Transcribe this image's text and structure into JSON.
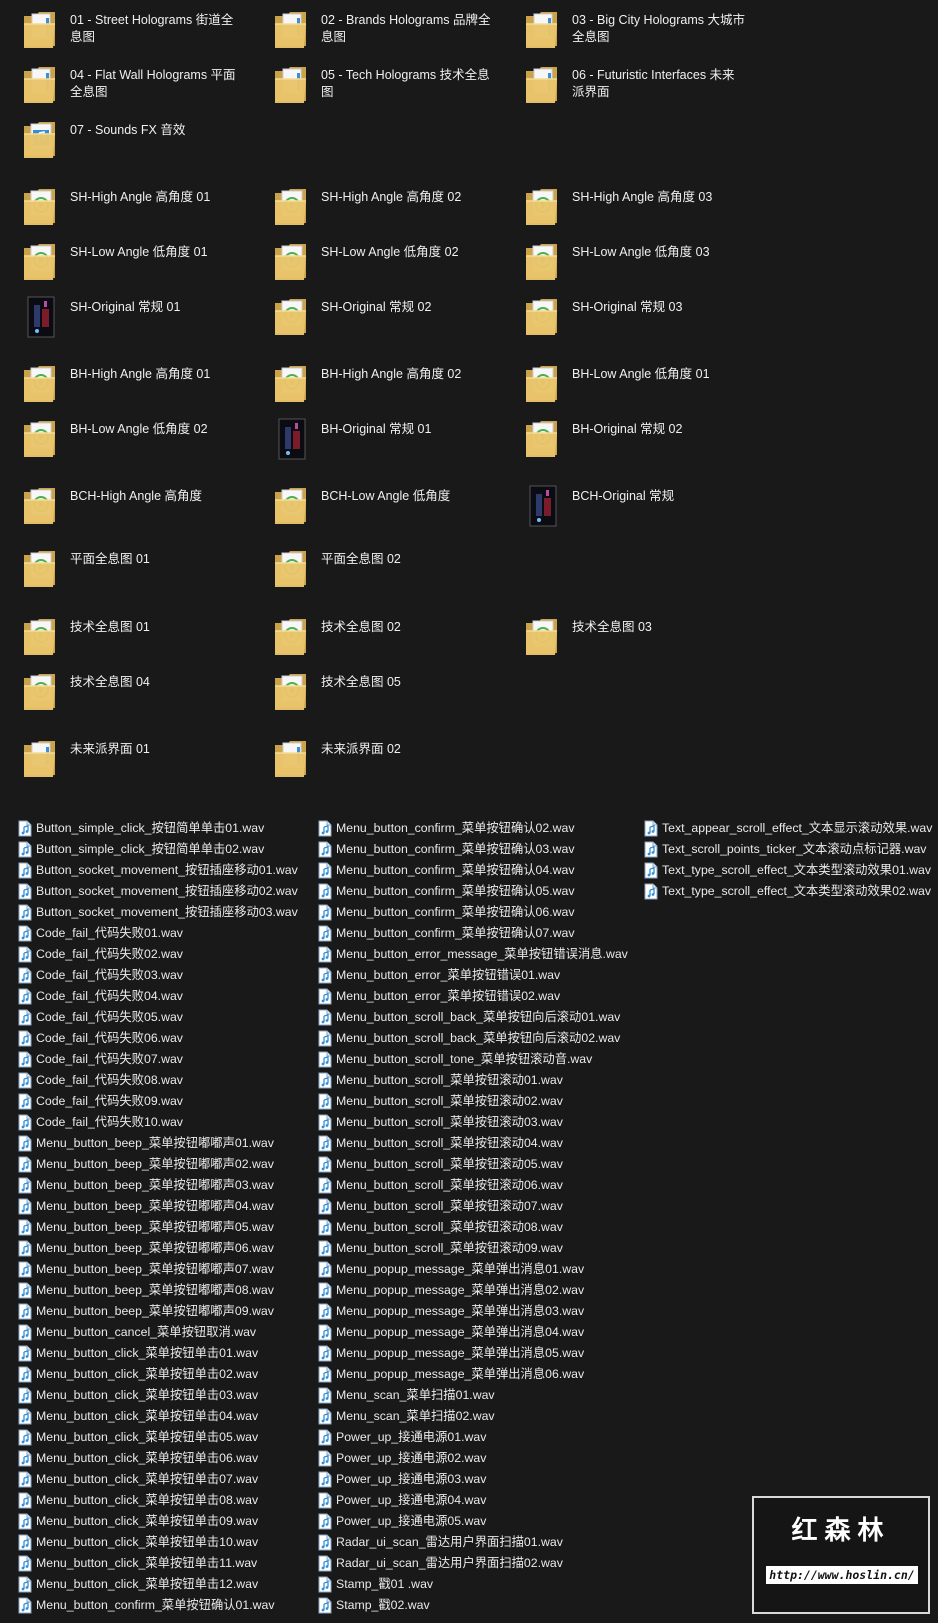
{
  "folders": [
    {
      "name": "01 - Street Holograms 街道全息图",
      "kind": "folder-docs"
    },
    {
      "name": "02 - Brands Holograms 品牌全息图",
      "kind": "folder-docs"
    },
    {
      "name": "03 - Big City Holograms 大城市全息图",
      "kind": "folder-docs"
    },
    {
      "name": "04 - Flat Wall Holograms 平面全息图",
      "kind": "folder-docs"
    },
    {
      "name": "05 - Tech Holograms 技术全息图",
      "kind": "folder-docs"
    },
    {
      "name": "06 - Futuristic Interfaces 未来派界面",
      "kind": "folder-docs"
    },
    {
      "name": "07 - Sounds FX 音效",
      "kind": "folder-audio"
    },
    {
      "name": "SH-High Angle 高角度 01",
      "kind": "folder-media"
    },
    {
      "name": "SH-High Angle 高角度 02",
      "kind": "folder-media"
    },
    {
      "name": "SH-High Angle 高角度 03",
      "kind": "folder-media"
    },
    {
      "name": "SH-Low Angle 低角度 01",
      "kind": "folder-media"
    },
    {
      "name": "SH-Low Angle 低角度 02",
      "kind": "folder-media"
    },
    {
      "name": "SH-Low Angle 低角度 03",
      "kind": "folder-media"
    },
    {
      "name": "SH-Original 常规 01",
      "kind": "video-thumb"
    },
    {
      "name": "SH-Original 常规 02",
      "kind": "folder-media"
    },
    {
      "name": "SH-Original 常规 03",
      "kind": "folder-media"
    },
    {
      "name": "BH-High Angle 高角度 01",
      "kind": "folder-media"
    },
    {
      "name": "BH-High Angle 高角度 02",
      "kind": "folder-media"
    },
    {
      "name": "BH-Low Angle 低角度 01",
      "kind": "folder-media"
    },
    {
      "name": "BH-Low Angle 低角度 02",
      "kind": "folder-media"
    },
    {
      "name": "BH-Original 常规 01",
      "kind": "video-thumb"
    },
    {
      "name": "BH-Original 常规 02",
      "kind": "folder-media"
    },
    {
      "name": "BCH-High Angle 高角度",
      "kind": "folder-media"
    },
    {
      "name": "BCH-Low Angle 低角度",
      "kind": "folder-media"
    },
    {
      "name": "BCH-Original 常规",
      "kind": "video-thumb"
    },
    {
      "name": "平面全息图 01",
      "kind": "folder-media"
    },
    {
      "name": "平面全息图 02",
      "kind": "folder-media"
    },
    {
      "name": "技术全息图 01",
      "kind": "folder-media"
    },
    {
      "name": "技术全息图 02",
      "kind": "folder-media"
    },
    {
      "name": "技术全息图 03",
      "kind": "folder-media"
    },
    {
      "name": "技术全息图 04",
      "kind": "folder-media"
    },
    {
      "name": "技术全息图 05",
      "kind": "folder-media"
    },
    {
      "name": "未来派界面 01",
      "kind": "folder-docs"
    },
    {
      "name": "未来派界面 02",
      "kind": "folder-docs"
    }
  ],
  "wav_columns": [
    [
      "Button_simple_click_按钮简单单击01.wav",
      "Button_simple_click_按钮简单单击02.wav",
      "Button_socket_movement_按钮插座移动01.wav",
      "Button_socket_movement_按钮插座移动02.wav",
      "Button_socket_movement_按钮插座移动03.wav",
      "Code_fail_代码失败01.wav",
      "Code_fail_代码失败02.wav",
      "Code_fail_代码失败03.wav",
      "Code_fail_代码失败04.wav",
      "Code_fail_代码失败05.wav",
      "Code_fail_代码失败06.wav",
      "Code_fail_代码失败07.wav",
      "Code_fail_代码失败08.wav",
      "Code_fail_代码失败09.wav",
      "Code_fail_代码失败10.wav",
      "Menu_button_beep_菜单按钮嘟嘟声01.wav",
      "Menu_button_beep_菜单按钮嘟嘟声02.wav",
      "Menu_button_beep_菜单按钮嘟嘟声03.wav",
      "Menu_button_beep_菜单按钮嘟嘟声04.wav",
      "Menu_button_beep_菜单按钮嘟嘟声05.wav",
      "Menu_button_beep_菜单按钮嘟嘟声06.wav",
      "Menu_button_beep_菜单按钮嘟嘟声07.wav",
      "Menu_button_beep_菜单按钮嘟嘟声08.wav",
      "Menu_button_beep_菜单按钮嘟嘟声09.wav",
      "Menu_button_cancel_菜单按钮取消.wav",
      "Menu_button_click_菜单按钮单击01.wav",
      "Menu_button_click_菜单按钮单击02.wav",
      "Menu_button_click_菜单按钮单击03.wav",
      "Menu_button_click_菜单按钮单击04.wav",
      "Menu_button_click_菜单按钮单击05.wav",
      "Menu_button_click_菜单按钮单击06.wav",
      "Menu_button_click_菜单按钮单击07.wav",
      "Menu_button_click_菜单按钮单击08.wav",
      "Menu_button_click_菜单按钮单击09.wav",
      "Menu_button_click_菜单按钮单击10.wav",
      "Menu_button_click_菜单按钮单击11.wav",
      "Menu_button_click_菜单按钮单击12.wav",
      "Menu_button_confirm_菜单按钮确认01.wav"
    ],
    [
      "Menu_button_confirm_菜单按钮确认02.wav",
      "Menu_button_confirm_菜单按钮确认03.wav",
      "Menu_button_confirm_菜单按钮确认04.wav",
      "Menu_button_confirm_菜单按钮确认05.wav",
      "Menu_button_confirm_菜单按钮确认06.wav",
      "Menu_button_confirm_菜单按钮确认07.wav",
      "Menu_button_error_message_菜单按钮错误消息.wav",
      "Menu_button_error_菜单按钮错误01.wav",
      "Menu_button_error_菜单按钮错误02.wav",
      "Menu_button_scroll_back_菜单按钮向后滚动01.wav",
      "Menu_button_scroll_back_菜单按钮向后滚动02.wav",
      "Menu_button_scroll_tone_菜单按钮滚动音.wav",
      "Menu_button_scroll_菜单按钮滚动01.wav",
      "Menu_button_scroll_菜单按钮滚动02.wav",
      "Menu_button_scroll_菜单按钮滚动03.wav",
      "Menu_button_scroll_菜单按钮滚动04.wav",
      "Menu_button_scroll_菜单按钮滚动05.wav",
      "Menu_button_scroll_菜单按钮滚动06.wav",
      "Menu_button_scroll_菜单按钮滚动07.wav",
      "Menu_button_scroll_菜单按钮滚动08.wav",
      "Menu_button_scroll_菜单按钮滚动09.wav",
      "Menu_popup_message_菜单弹出消息01.wav",
      "Menu_popup_message_菜单弹出消息02.wav",
      "Menu_popup_message_菜单弹出消息03.wav",
      "Menu_popup_message_菜单弹出消息04.wav",
      "Menu_popup_message_菜单弹出消息05.wav",
      "Menu_popup_message_菜单弹出消息06.wav",
      "Menu_scan_菜单扫描01.wav",
      "Menu_scan_菜单扫描02.wav",
      "Power_up_接通电源01.wav",
      "Power_up_接通电源02.wav",
      "Power_up_接通电源03.wav",
      "Power_up_接通电源04.wav",
      "Power_up_接通电源05.wav",
      "Radar_ui_scan_雷达用户界面扫描01.wav",
      "Radar_ui_scan_雷达用户界面扫描02.wav",
      "Stamp_戳01 .wav",
      "Stamp_戳02.wav"
    ],
    [
      "Text_appear_scroll_effect_文本显示滚动效果.wav",
      "Text_scroll_points_ticker_文本滚动点标记器.wav",
      "Text_type_scroll_effect_文本类型滚动效果01.wav",
      "Text_type_scroll_effect_文本类型滚动效果02.wav"
    ]
  ],
  "watermark": {
    "brand": "红森林",
    "url": "http://www.hoslin.cn/"
  },
  "colors": {
    "background": "#191919",
    "folder": "#e8c46a",
    "audio_icon": "#2f8fd8",
    "media_badge": "#4caf50"
  }
}
